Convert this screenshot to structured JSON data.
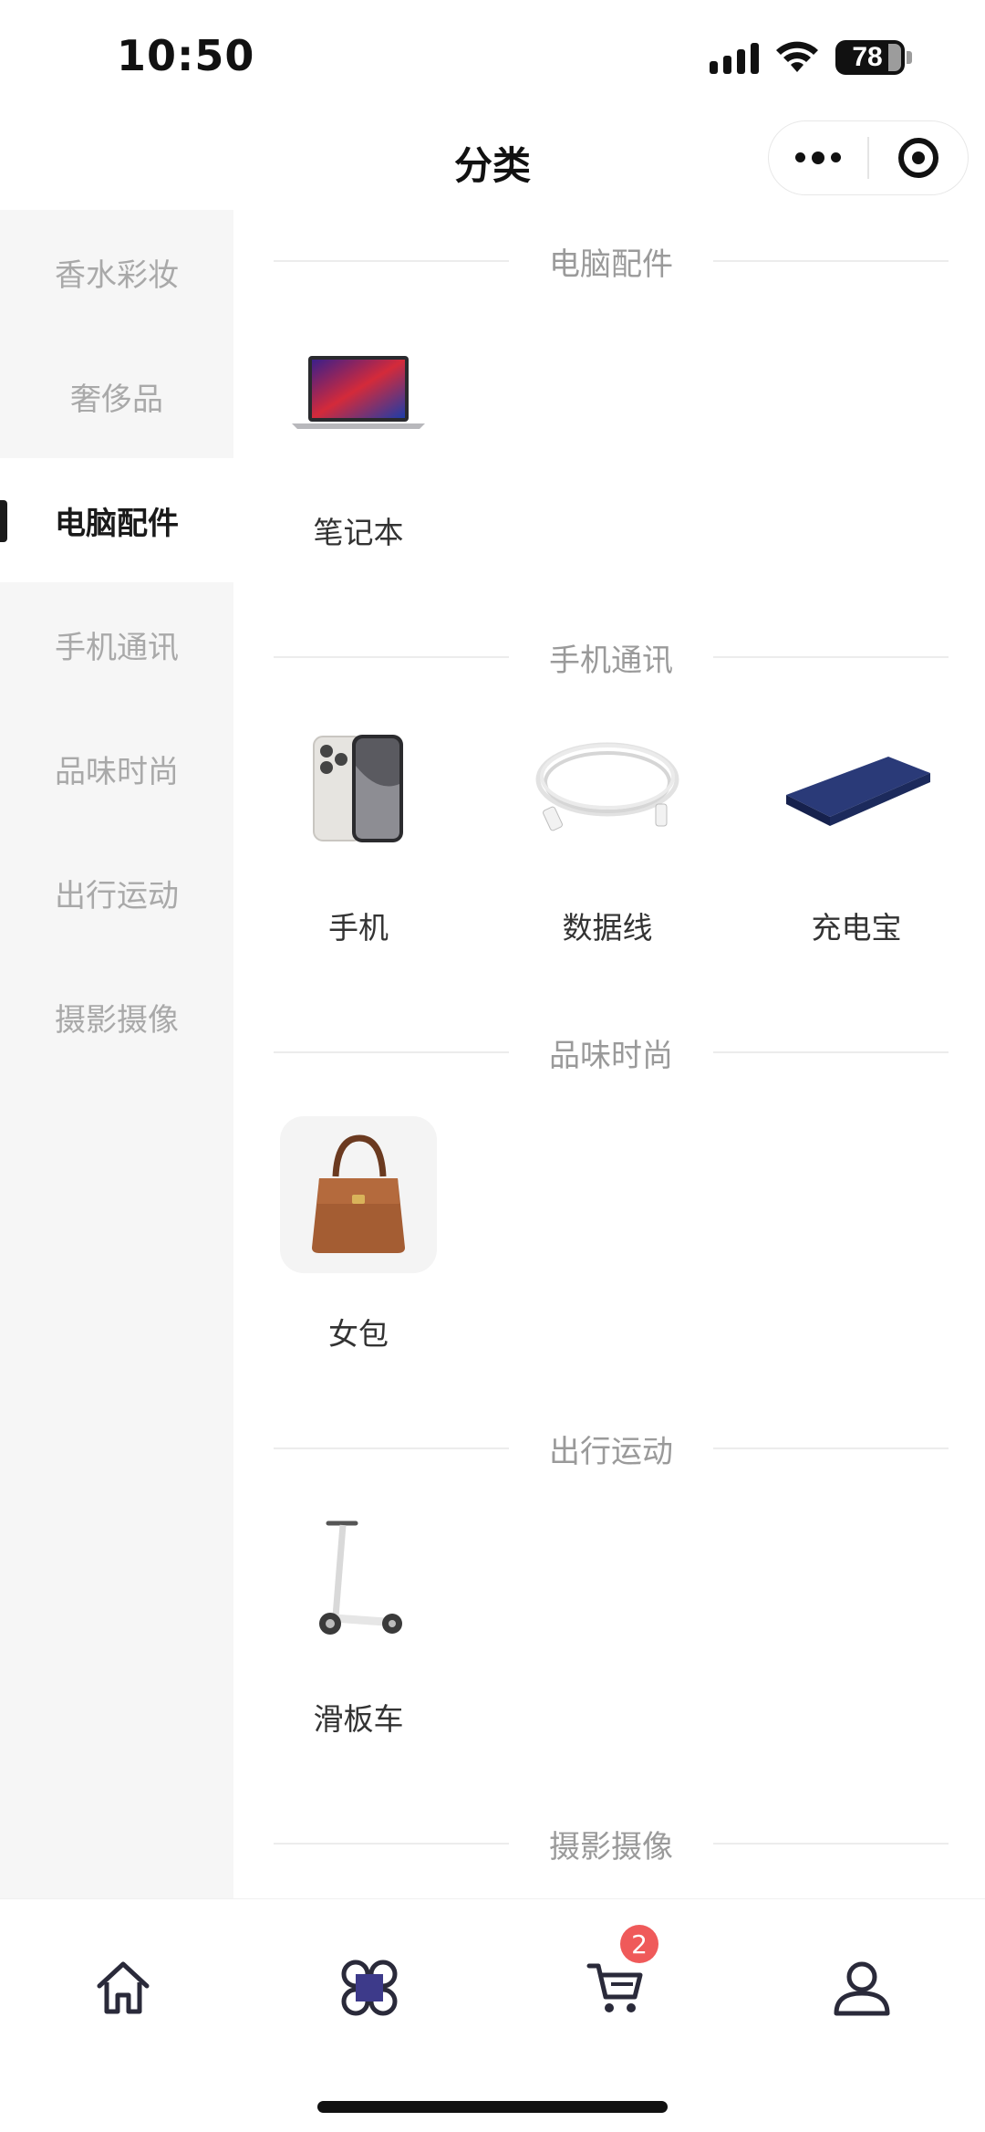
{
  "status_bar": {
    "time": "10:50",
    "battery": "78"
  },
  "nav": {
    "title": "分类"
  },
  "sidebar": {
    "items": [
      {
        "label": "香水彩妆"
      },
      {
        "label": "奢侈品"
      },
      {
        "label": "电脑配件",
        "active": true
      },
      {
        "label": "手机通讯"
      },
      {
        "label": "品味时尚"
      },
      {
        "label": "出行运动"
      },
      {
        "label": "摄影摄像"
      }
    ]
  },
  "sections": [
    {
      "title": "电脑配件",
      "products": [
        {
          "name": "笔记本",
          "icon": "laptop-icon"
        }
      ]
    },
    {
      "title": "手机通讯",
      "products": [
        {
          "name": "手机",
          "icon": "phone-icon"
        },
        {
          "name": "数据线",
          "icon": "cable-icon"
        },
        {
          "name": "充电宝",
          "icon": "power-bank-icon"
        }
      ]
    },
    {
      "title": "品味时尚",
      "products": [
        {
          "name": "女包",
          "icon": "handbag-icon"
        }
      ]
    },
    {
      "title": "出行运动",
      "products": [
        {
          "name": "滑板车",
          "icon": "scooter-icon"
        }
      ]
    },
    {
      "title": "摄影摄像",
      "products": []
    }
  ],
  "tab_bar": {
    "tabs": [
      {
        "icon": "home-icon"
      },
      {
        "icon": "category-icon",
        "active": true
      },
      {
        "icon": "cart-icon",
        "badge": "2"
      },
      {
        "icon": "user-icon"
      }
    ]
  },
  "colors": {
    "accent": "#1a1a1a",
    "badge": "#ef5a5a",
    "sidebar_bg": "#f6f6f6",
    "category_tint": "#3d3a8a"
  }
}
